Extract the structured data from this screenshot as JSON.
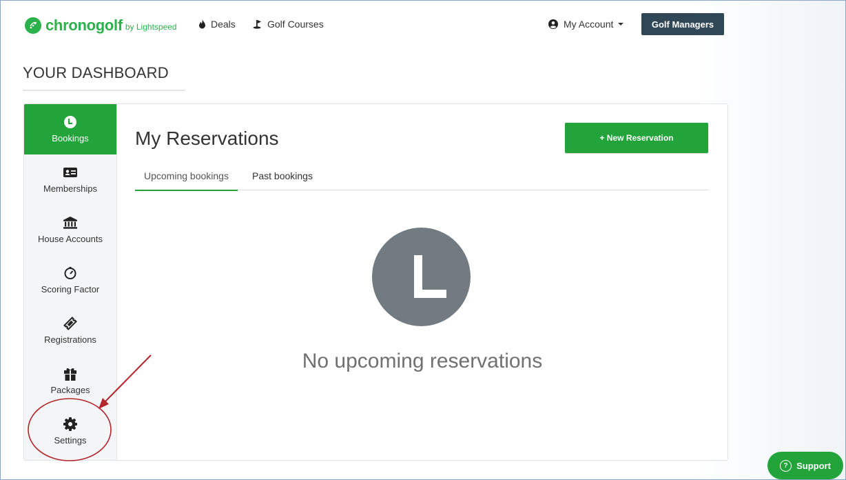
{
  "nav": {
    "logo_text": "chronogolf",
    "logo_by": "by Lightspeed",
    "deals": "Deals",
    "golf_courses": "Golf Courses",
    "my_account": "My Account",
    "golf_managers": "Golf Managers"
  },
  "page_title": "YOUR DASHBOARD",
  "sidebar": {
    "items": [
      {
        "label": "Bookings",
        "icon": "clock-icon",
        "active": true
      },
      {
        "label": "Memberships",
        "icon": "id-card-icon",
        "active": false
      },
      {
        "label": "House Accounts",
        "icon": "bank-icon",
        "active": false
      },
      {
        "label": "Scoring Factor",
        "icon": "gauge-icon",
        "active": false
      },
      {
        "label": "Registrations",
        "icon": "ticket-icon",
        "active": false
      },
      {
        "label": "Packages",
        "icon": "gift-icon",
        "active": false
      },
      {
        "label": "Settings",
        "icon": "gear-icon",
        "active": false
      }
    ]
  },
  "main": {
    "title": "My Reservations",
    "new_button": "+ New Reservation",
    "tabs": [
      {
        "label": "Upcoming bookings",
        "active": true
      },
      {
        "label": "Past bookings",
        "active": false
      }
    ],
    "empty_message": "No upcoming reservations"
  },
  "support": {
    "label": "Support"
  },
  "colors": {
    "brand_green": "#22a43a",
    "dark_button": "#2f4756",
    "annotation_red": "#b3262d",
    "empty_icon_gray": "#737b82"
  }
}
